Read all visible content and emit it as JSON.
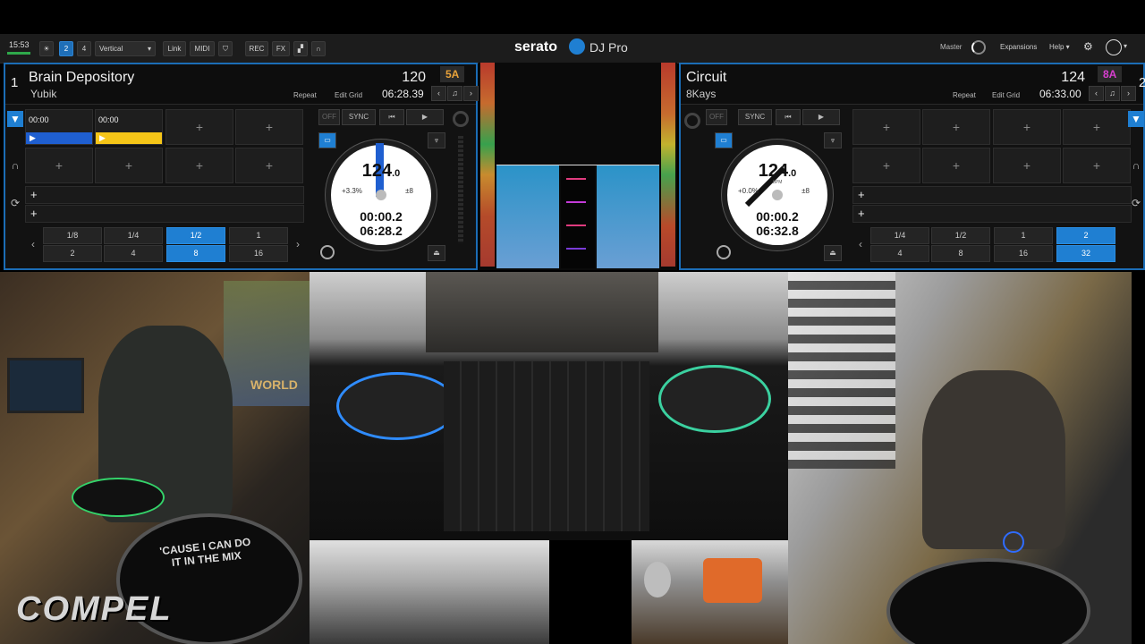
{
  "topbar": {
    "clock": "15:53",
    "deck_count_2": "2",
    "deck_count_4": "4",
    "layout_select": "Vertical",
    "link": "Link",
    "midi": "MIDI",
    "rec": "REC",
    "fx": "FX",
    "brand_serato": "serato",
    "brand_djpro": "DJ Pro",
    "master_label": "Master",
    "expansions": "Expansions",
    "help": "Help"
  },
  "deck_left": {
    "number": "1",
    "title": "Brain Depository",
    "artist": "Yubik",
    "bpm": "120",
    "key": "5A",
    "repeat": "Repeat",
    "edit_grid": "Edit Grid",
    "duration": "06:28.39",
    "cue1_time": "00:00",
    "cue2_time": "00:00",
    "off": "OFF",
    "sync": "SYNC",
    "platter_bpm": "124",
    "platter_bpm_dec": ".0",
    "pitch": "+3.3%",
    "range": "±8",
    "elapsed": "00:00.2",
    "remaining": "06:28.2",
    "beats_top": [
      "1/8",
      "1/4",
      "1/2",
      "1"
    ],
    "beats_bottom": [
      "2",
      "4",
      "8",
      "16"
    ],
    "selected_beat": "8"
  },
  "deck_right": {
    "number": "2",
    "title": "Circuit",
    "artist": "8Kays",
    "bpm": "124",
    "key": "8A",
    "repeat": "Repeat",
    "edit_grid": "Edit Grid",
    "duration": "06:33.00",
    "off": "OFF",
    "sync": "SYNC",
    "platter_bpm": "124",
    "platter_bpm_dec": ".0",
    "bpm_label": "BPM",
    "pitch": "+0.0%",
    "range": "±8",
    "elapsed": "00:00.2",
    "remaining": "06:32.8",
    "beats_top": [
      "1/4",
      "1/2",
      "1",
      "2"
    ],
    "beats_bottom": [
      "4",
      "8",
      "16",
      "32"
    ],
    "selected_beat": "32"
  },
  "video": {
    "logo": "COMPEL",
    "sticker_text": "'CAUSE I CAN DO IT IN THE MIX",
    "banner_text": "WORLD"
  },
  "colors": {
    "accent_blue": "#1f7fd2",
    "cue_blue": "#1f5fd0",
    "cue_yellow": "#f5c518",
    "key_left": "#e8a23a",
    "key_right": "#d83fd0",
    "deck_border": "#1b6db6"
  }
}
